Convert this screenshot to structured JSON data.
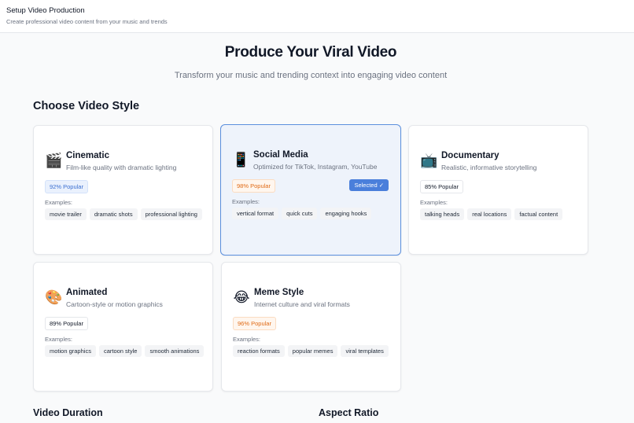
{
  "header": {
    "title": "Setup Video Production",
    "subtitle": "Create professional video content from your music and trends"
  },
  "hero": {
    "title": "Produce Your Viral Video",
    "subtitle": "Transform your music and trending context into engaging video content"
  },
  "sections": {
    "style_title": "Choose Video Style",
    "duration_title": "Video Duration",
    "aspect_title": "Aspect Ratio"
  },
  "styles": [
    {
      "emoji": "🎬",
      "icon": "clapper-board-icon",
      "name": "Cinematic",
      "description": "Film-like quality with dramatic lighting",
      "popularity": "92% Popular",
      "popularity_color": "#3b6fd1",
      "examples_label": "Examples:",
      "examples": [
        "movie trailer",
        "dramatic shots",
        "professional lighting"
      ]
    },
    {
      "emoji": "📱",
      "icon": "mobile-phone-icon",
      "name": "Social Media",
      "description": "Optimized for TikTok, Instagram, YouTube",
      "popularity": "98% Popular",
      "popularity_color": "#e06b16",
      "selected": true,
      "selected_label": "Selected ✓",
      "examples_label": "Examples:",
      "examples": [
        "vertical format",
        "quick cuts",
        "engaging hooks"
      ]
    },
    {
      "emoji": "📺",
      "icon": "television-icon",
      "name": "Documentary",
      "description": "Realistic, informative storytelling",
      "popularity": "85% Popular",
      "popularity_color": "#111827",
      "examples_label": "Examples:",
      "examples": [
        "talking heads",
        "real locations",
        "factual content"
      ]
    },
    {
      "emoji": "🎨",
      "icon": "artist-palette-icon",
      "name": "Animated",
      "description": "Cartoon-style or motion graphics",
      "popularity": "89% Popular",
      "popularity_color": "#111827",
      "examples_label": "Examples:",
      "examples": [
        "motion graphics",
        "cartoon style",
        "smooth animations"
      ]
    },
    {
      "emoji": "😂",
      "icon": "laughing-face-icon",
      "name": "Meme Style",
      "description": "Internet culture and viral formats",
      "popularity": "96% Popular",
      "popularity_color": "#e06b16",
      "examples_label": "Examples:",
      "examples": [
        "reaction formats",
        "popular memes",
        "viral templates"
      ]
    }
  ]
}
